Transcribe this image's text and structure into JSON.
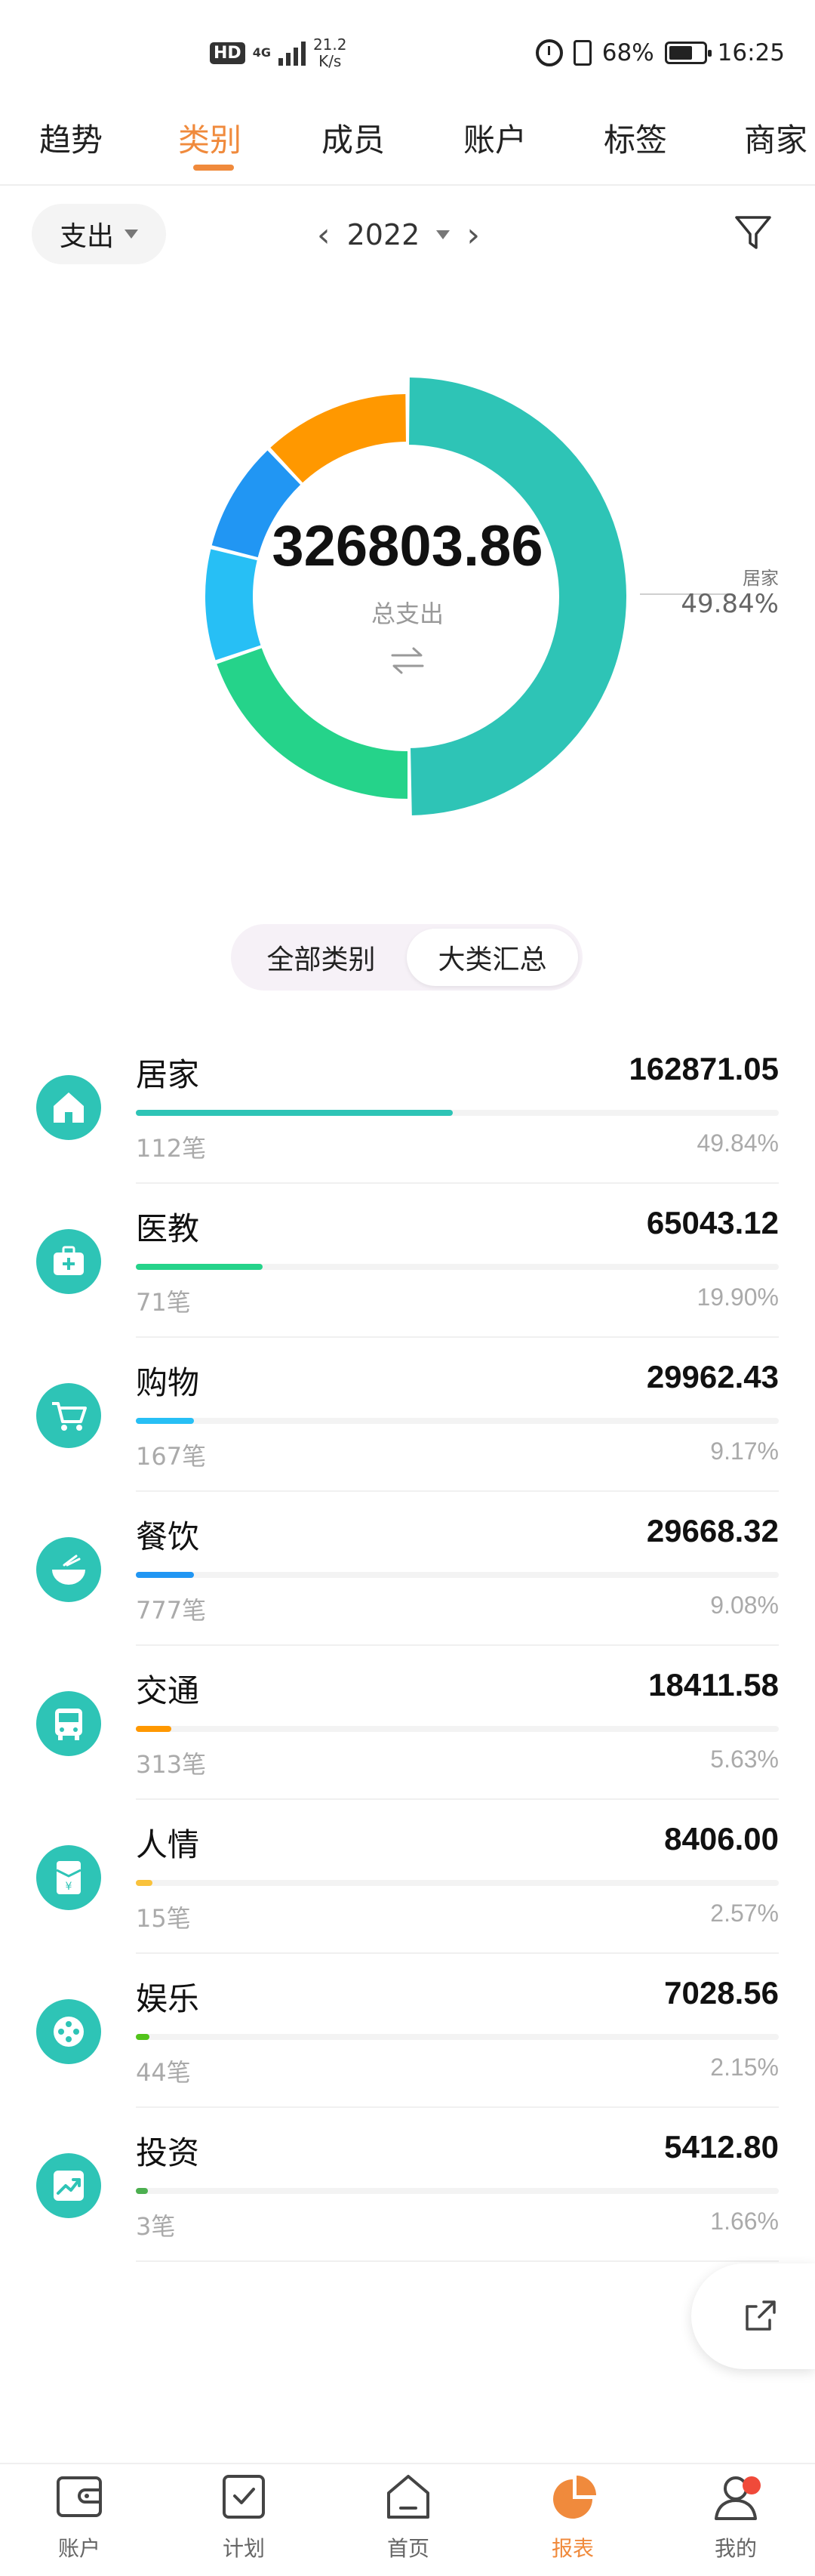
{
  "status_bar": {
    "hd": "HD",
    "network": "4G",
    "speed_value": "21.2",
    "speed_unit": "K/s",
    "battery": "68%",
    "time": "16:25"
  },
  "tabs": [
    "趋势",
    "类别",
    "成员",
    "账户",
    "标签",
    "商家"
  ],
  "active_tab": "类别",
  "filter": {
    "type_label": "支出",
    "year": "2022"
  },
  "summary": {
    "total": "326803.86",
    "total_label": "总支出",
    "callout_label": "居家",
    "callout_pct": "49.84%"
  },
  "segmented": {
    "all_label": "全部类别",
    "major_label": "大类汇总",
    "active": "大类汇总"
  },
  "categories": [
    {
      "name": "居家",
      "amount": "162871.05",
      "count": "112笔",
      "percent": "49.84%",
      "share": 49.84,
      "color": "#2ec4b6",
      "icon": "home-icon"
    },
    {
      "name": "医教",
      "amount": "65043.12",
      "count": "71笔",
      "percent": "19.90%",
      "share": 19.9,
      "color": "#25d38a",
      "icon": "medical-kit-icon"
    },
    {
      "name": "购物",
      "amount": "29962.43",
      "count": "167笔",
      "percent": "9.17%",
      "share": 9.17,
      "color": "#27bff5",
      "icon": "shopping-cart-icon"
    },
    {
      "name": "餐饮",
      "amount": "29668.32",
      "count": "777笔",
      "percent": "9.08%",
      "share": 9.08,
      "color": "#2196f3",
      "icon": "food-bowl-icon"
    },
    {
      "name": "交通",
      "amount": "18411.58",
      "count": "313笔",
      "percent": "5.63%",
      "share": 5.63,
      "color": "#ff9800",
      "icon": "bus-icon"
    },
    {
      "name": "人情",
      "amount": "8406.00",
      "count": "15笔",
      "percent": "2.57%",
      "share": 2.57,
      "color": "#f9c23c",
      "icon": "red-envelope-icon"
    },
    {
      "name": "娱乐",
      "amount": "7028.56",
      "count": "44笔",
      "percent": "2.15%",
      "share": 2.15,
      "color": "#52c41a",
      "icon": "film-reel-icon"
    },
    {
      "name": "投资",
      "amount": "5412.80",
      "count": "3笔",
      "percent": "1.66%",
      "share": 1.66,
      "color": "#4caf50",
      "icon": "trend-up-icon"
    }
  ],
  "bottom_nav": [
    {
      "label": "账户",
      "icon": "wallet-icon"
    },
    {
      "label": "计划",
      "icon": "checklist-icon"
    },
    {
      "label": "首页",
      "icon": "home-outline-icon"
    },
    {
      "label": "报表",
      "icon": "pie-chart-icon"
    },
    {
      "label": "我的",
      "icon": "user-icon"
    }
  ],
  "active_nav": "报表",
  "chart_data": {
    "type": "pie",
    "categories": [
      "居家",
      "医教",
      "购物",
      "餐饮",
      "交通",
      "人情",
      "娱乐",
      "投资"
    ],
    "values": [
      162871.05,
      65043.12,
      29962.43,
      29668.32,
      18411.58,
      8406.0,
      7028.56,
      5412.8
    ],
    "visible_segments": [
      {
        "label": "居家",
        "share": 49.84,
        "color": "#2ec4b6"
      },
      {
        "label": "医教",
        "share": 19.9,
        "color": "#25d38a"
      },
      {
        "label": "购物",
        "share": 9.17,
        "color": "#27bff5"
      },
      {
        "label": "餐饮",
        "share": 9.08,
        "color": "#2196f3"
      },
      {
        "label": "交通",
        "share": 12.01,
        "color": "#ff9800"
      }
    ],
    "title": "",
    "legend": "callout-right"
  }
}
